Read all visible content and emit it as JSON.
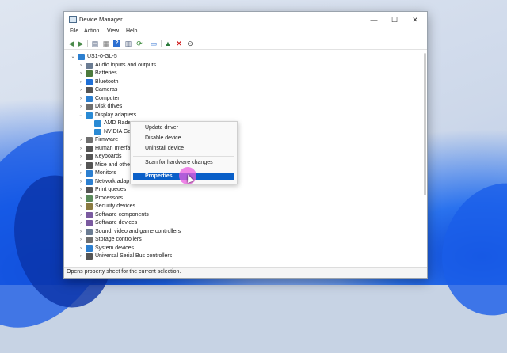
{
  "window": {
    "title": "Device Manager",
    "controls": [
      "—",
      "☐",
      "✕"
    ]
  },
  "menu": [
    "File",
    "Action",
    "View",
    "Help"
  ],
  "toolbar_icons": [
    "back-icon",
    "forward-icon",
    "properties-icon",
    "list-icon",
    "help-icon",
    "panel-icon",
    "scan-icon",
    "monitor-icon",
    "update-driver-icon",
    "uninstall-icon",
    "download-icon"
  ],
  "tree": {
    "root": "US1-0-GL-5",
    "items": [
      {
        "label": "Audio inputs and outputs",
        "icon": "audio-icon",
        "color": "#6b7c93"
      },
      {
        "label": "Batteries",
        "icon": "battery-icon",
        "color": "#4c7a3c"
      },
      {
        "label": "Bluetooth",
        "icon": "bluetooth-icon",
        "color": "#1f6fd6"
      },
      {
        "label": "Cameras",
        "icon": "camera-icon",
        "color": "#555555"
      },
      {
        "label": "Computer",
        "icon": "computer-icon",
        "color": "#2c7fd0"
      },
      {
        "label": "Disk drives",
        "icon": "disk-icon",
        "color": "#6f6f6f"
      },
      {
        "label": "Display adapters",
        "icon": "display-adapter-icon",
        "color": "#2a8ad4"
      }
    ],
    "display_children": [
      {
        "label": "AMD Radeon",
        "icon": "gpu-icon"
      },
      {
        "label": "NVIDIA Ge",
        "icon": "gpu-icon"
      }
    ],
    "items_after": [
      {
        "label": "Firmware",
        "icon": "firmware-icon",
        "color": "#6f6f6f"
      },
      {
        "label": "Human Interfa",
        "icon": "hid-icon",
        "color": "#555555"
      },
      {
        "label": "Keyboards",
        "icon": "keyboard-icon",
        "color": "#555555"
      },
      {
        "label": "Mice and othe",
        "icon": "mouse-icon",
        "color": "#555555"
      },
      {
        "label": "Monitors",
        "icon": "monitor-icon",
        "color": "#2c7fd0"
      },
      {
        "label": "Network adap",
        "icon": "network-icon",
        "color": "#2c7fd0"
      },
      {
        "label": "Print queues",
        "icon": "printer-icon",
        "color": "#555555"
      },
      {
        "label": "Processors",
        "icon": "processor-icon",
        "color": "#5a8a5a"
      },
      {
        "label": "Security devices",
        "icon": "security-icon",
        "color": "#8a7a40"
      },
      {
        "label": "Software components",
        "icon": "software-component-icon",
        "color": "#7a5aa0"
      },
      {
        "label": "Software devices",
        "icon": "software-device-icon",
        "color": "#7a5aa0"
      },
      {
        "label": "Sound, video and game controllers",
        "icon": "sound-icon",
        "color": "#6b7c93"
      },
      {
        "label": "Storage controllers",
        "icon": "storage-icon",
        "color": "#6f6f6f"
      },
      {
        "label": "System devices",
        "icon": "system-icon",
        "color": "#2c7fd0"
      },
      {
        "label": "Universal Serial Bus controllers",
        "icon": "usb-icon",
        "color": "#555555"
      }
    ]
  },
  "context_menu": {
    "items": [
      "Update driver",
      "Disable device",
      "Uninstall device",
      "Scan for hardware changes",
      "Properties"
    ],
    "highlighted": "Properties"
  },
  "status": "Opens property sheet for the current selection."
}
